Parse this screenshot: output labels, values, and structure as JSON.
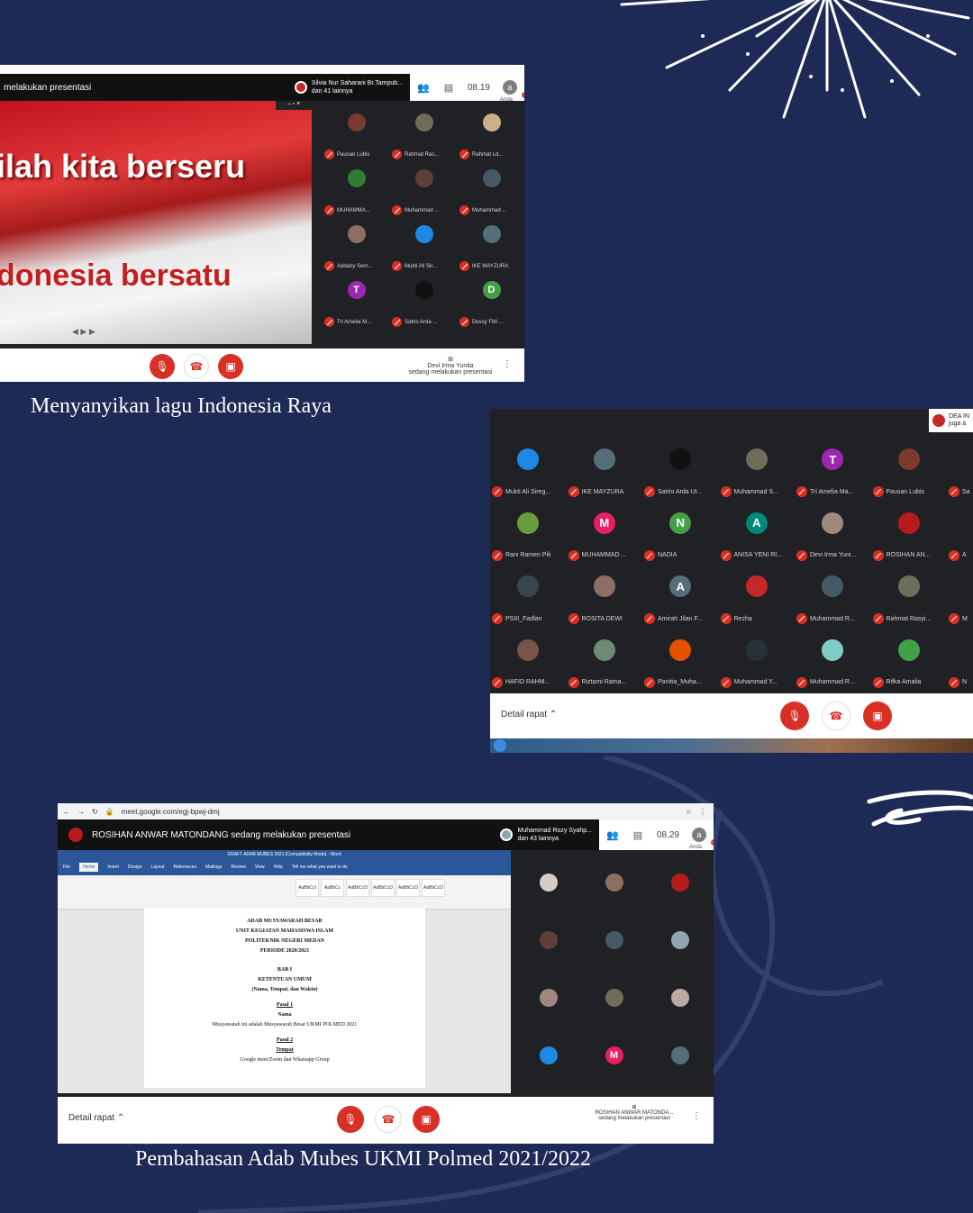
{
  "colors": {
    "background": "#1c2a55",
    "mute_red": "#d93025",
    "caption": "#ffffff"
  },
  "screen1": {
    "presenting_label": "melakukan presentasi",
    "presenter_name": "Silvia Nur Saharani Br.Tampub...",
    "presenter_others": "dan 41 lainnya",
    "time": "08.19",
    "self_label": "Anda",
    "self_initial": "a",
    "slide_line1": "ilah kita berseru",
    "slide_line2": "donesia bersatu",
    "participants": [
      {
        "name": "Pausan Lubis",
        "initial": "",
        "color": "#7a3b2e"
      },
      {
        "name": "Rahmat Ras...",
        "initial": "",
        "color": "#6d6d5a"
      },
      {
        "name": "Rahmat Ld...",
        "initial": "",
        "color": "#c9b08a"
      },
      {
        "name": "MUHAMMA...",
        "initial": "",
        "color": "#2e7d32"
      },
      {
        "name": "Muhammad ...",
        "initial": "",
        "color": "#5d4037"
      },
      {
        "name": "Muhammad ...",
        "initial": "",
        "color": "#455a64"
      },
      {
        "name": "Addariy Sem...",
        "initial": "",
        "color": "#8d6e63"
      },
      {
        "name": "Mukti Ali Sir...",
        "initial": "",
        "color": "#1e88e5"
      },
      {
        "name": "IKE MAYZURA",
        "initial": "",
        "color": "#546e7a"
      },
      {
        "name": "Tri Amelia M...",
        "initial": "T",
        "color": "#9c27b0"
      },
      {
        "name": "Satrio Arda ...",
        "initial": "",
        "color": "#111111"
      },
      {
        "name": "Dessy Fitri ...",
        "initial": "D",
        "color": "#43a047"
      }
    ],
    "presenting_footer": "Devi Irma Yunita",
    "presenting_footer2": "sedang melakukan presentasi"
  },
  "caption1": "Menyanyikan lagu Indonesia Raya",
  "screen2": {
    "top_name": "DEA IN",
    "top_others": "juga a",
    "participants": [
      {
        "name": "Mukti Ali Sireg...",
        "initial": "",
        "color": "#1e88e5"
      },
      {
        "name": "IKE MAYZURA",
        "initial": "",
        "color": "#546e7a"
      },
      {
        "name": "Satrio Arda Ut...",
        "initial": "",
        "color": "#111111"
      },
      {
        "name": "Muhammad S...",
        "initial": "",
        "color": "#6d6d5a"
      },
      {
        "name": "Tri Amelia Ma...",
        "initial": "T",
        "color": "#9c27b0"
      },
      {
        "name": "Pausan Lubis",
        "initial": "",
        "color": "#7a3b2e"
      },
      {
        "name": "Sa",
        "initial": "",
        "color": "#555555"
      },
      {
        "name": "Rani Ramen Pili",
        "initial": "",
        "color": "#689f38"
      },
      {
        "name": "MUHAMMAD ...",
        "initial": "M",
        "color": "#e91e63"
      },
      {
        "name": "NADIA",
        "initial": "N",
        "color": "#43a047"
      },
      {
        "name": "ANISA YENI RI...",
        "initial": "A",
        "color": "#00897b"
      },
      {
        "name": "Devi Irma Yuni...",
        "initial": "",
        "color": "#a1887f"
      },
      {
        "name": "ROSIHAN AN...",
        "initial": "",
        "color": "#b71c1c"
      },
      {
        "name": "A",
        "initial": "",
        "color": "#555555"
      },
      {
        "name": "PSIII_Fadlan",
        "initial": "",
        "color": "#37474f"
      },
      {
        "name": "ROSITA DEWI",
        "initial": "",
        "color": "#8d6e63"
      },
      {
        "name": "Amirah Jilan F...",
        "initial": "A",
        "color": "#546e7a"
      },
      {
        "name": "Rezha",
        "initial": "",
        "color": "#c62828"
      },
      {
        "name": "Muhammad R...",
        "initial": "",
        "color": "#455a64"
      },
      {
        "name": "Rahmat Rasyi...",
        "initial": "",
        "color": "#6d6d5a"
      },
      {
        "name": "M",
        "initial": "",
        "color": "#555555"
      },
      {
        "name": "HAFID RAHM...",
        "initial": "",
        "color": "#795548"
      },
      {
        "name": "Riztami Rama...",
        "initial": "",
        "color": "#6d8b74"
      },
      {
        "name": "Panitia_Muha...",
        "initial": "",
        "color": "#e65100"
      },
      {
        "name": "Muhammad Y...",
        "initial": "",
        "color": "#263238"
      },
      {
        "name": "Muhammad R...",
        "initial": "",
        "color": "#80cbc4"
      },
      {
        "name": "Rifka Amalia",
        "initial": "",
        "color": "#43a047"
      },
      {
        "name": "N",
        "initial": "",
        "color": "#555555"
      }
    ],
    "detail_label": "Detail rapat"
  },
  "screen3": {
    "url": "meet.google.com/egj-bpwj-dmj",
    "presenting_title": "ROSIHAN ANWAR MATONDANG sedang melakukan presentasi",
    "presenter_name": "Muhammad Rozy Syahp...",
    "presenter_others": "dan 43 lainnya",
    "time": "08.29",
    "self_label": "Anda",
    "self_initial": "a",
    "doc_title": "DRAFT ADAB MUBES 2021 [Compatibility Mode] - Word",
    "ribbon_tabs": [
      "File",
      "Home",
      "Insert",
      "Design",
      "Layout",
      "References",
      "Mailings",
      "Review",
      "View",
      "Help",
      "Tell me what you want to do"
    ],
    "styles": [
      "AaBbCcI",
      "AaBbCc",
      "AaBbCcD",
      "AaBbCcD",
      "AaBbCcD",
      "AaBbCcD"
    ],
    "doc": {
      "h1": "ADAB MUSYAWARAH BESAR",
      "h2": "UNIT KEGIATAN MAHASISWA ISLAM",
      "h3": "POLITEKNIK NEGERI MEDAN",
      "h4": "PERIODE 2020/2021",
      "bab": "BAB I",
      "bab_title": "KETENTUAN UMUM",
      "bab_sub": "(Nama, Tempat, dan Waktu)",
      "p1": "Pasal 1",
      "p1t": "Nama",
      "p1b": "Musyawarah ini adalah Musyawarah Besar UKMI POLMED 2021",
      "p2": "Pasal 2",
      "p2t": "Tempat",
      "p2b": "Google meet/Zoom dan Whatsapp Group"
    },
    "participants": [
      {
        "initial": "",
        "color": "#d7ccc8"
      },
      {
        "initial": "",
        "color": "#8d6e63"
      },
      {
        "initial": "",
        "color": "#b71c1c"
      },
      {
        "initial": "",
        "color": "#5d4037"
      },
      {
        "initial": "",
        "color": "#455a64"
      },
      {
        "initial": "",
        "color": "#90a4ae"
      },
      {
        "initial": "",
        "color": "#a1887f"
      },
      {
        "initial": "",
        "color": "#6d6d5a"
      },
      {
        "initial": "",
        "color": "#bcaaa4"
      },
      {
        "initial": "",
        "color": "#1e88e5"
      },
      {
        "initial": "M",
        "color": "#e91e63"
      },
      {
        "initial": "",
        "color": "#546e7a"
      }
    ],
    "detail_label": "Detail rapat",
    "footer_name": "ROSIHAN ANWAR MATONDA...",
    "footer_sub": "sedang melakukan presentasi"
  },
  "caption2": "Pembahasan Adab Mubes UKMI Polmed 2021/2022"
}
